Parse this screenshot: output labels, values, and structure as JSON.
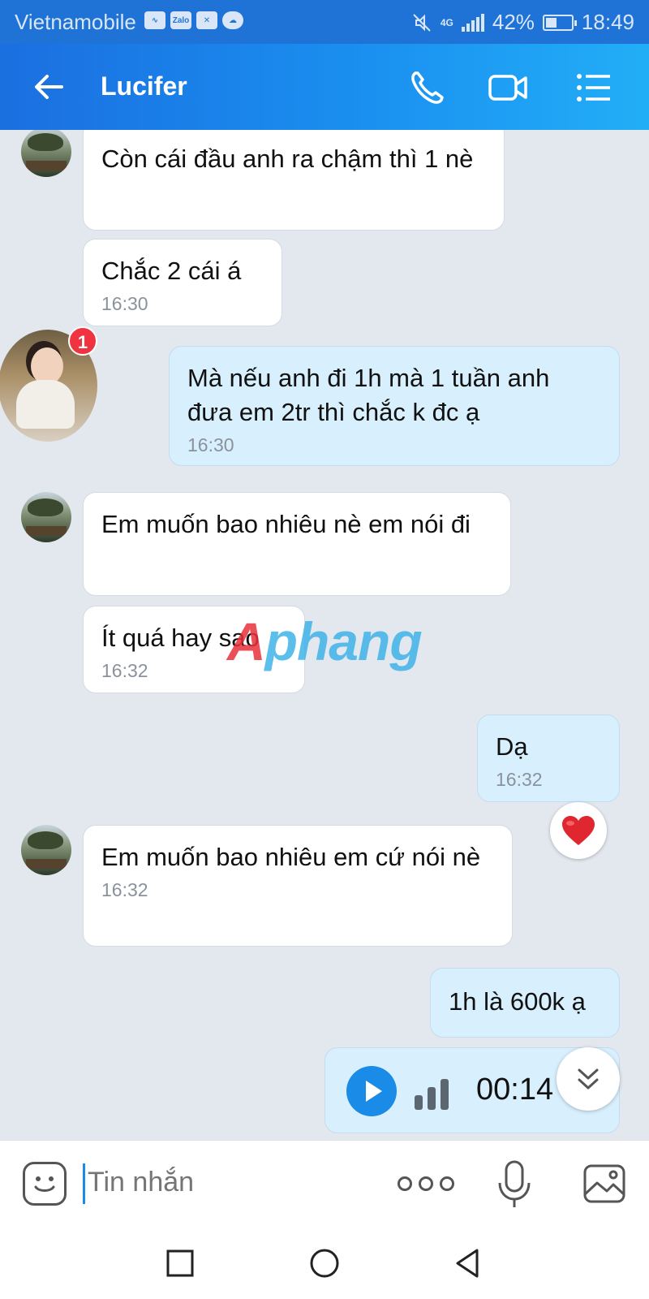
{
  "status_bar": {
    "carrier": "Vietnamobile",
    "network": "4G",
    "battery": "42%",
    "battery_level": 0.42,
    "time": "18:49"
  },
  "header": {
    "title": "Lucifer",
    "back_icon": "arrow-left-icon",
    "call_icon": "phone-icon",
    "video_icon": "video-camera-icon",
    "menu_icon": "menu-list-icon"
  },
  "badge_count": "1",
  "messages": [
    {
      "dir": "in",
      "text": "Còn cái đầu anh ra chậm thì 1 nè",
      "time": ""
    },
    {
      "dir": "in",
      "text": "Chắc 2 cái á",
      "time": "16:30"
    },
    {
      "dir": "out",
      "text": "Mà nếu anh đi 1h mà 1 tuần anh đưa em 2tr thì chắc k đc ạ",
      "time": "16:30"
    },
    {
      "dir": "in",
      "text": "Em muốn bao nhiêu nè em nói đi",
      "time": ""
    },
    {
      "dir": "in",
      "text": "Ít quá hay sao",
      "time": "16:32"
    },
    {
      "dir": "out",
      "text": "Dạ",
      "time": "16:32"
    },
    {
      "dir": "in",
      "text": "Em muốn bao nhiêu em cứ nói nè",
      "time": "16:32"
    },
    {
      "dir": "out",
      "text": "1h là 600k ạ",
      "time": ""
    }
  ],
  "voice_message": {
    "duration": "00:14",
    "icon": "play-icon"
  },
  "reaction": "heart-icon",
  "watermark": {
    "part1": "A",
    "part2": "phang"
  },
  "composer": {
    "placeholder": "Tin nhắn",
    "emoji_icon": "emoji-icon",
    "more_icon": "more-dots-icon",
    "mic_icon": "microphone-icon",
    "gallery_icon": "image-gallery-icon"
  },
  "colors": {
    "header_gradient_start": "#1b6fe0",
    "header_gradient_end": "#22aef7",
    "incoming_bubble": "#ffffff",
    "outgoing_bubble": "#d8effd",
    "chat_background": "#e3e8ef",
    "accent": "#1a8be6",
    "badge": "#ef3340"
  }
}
